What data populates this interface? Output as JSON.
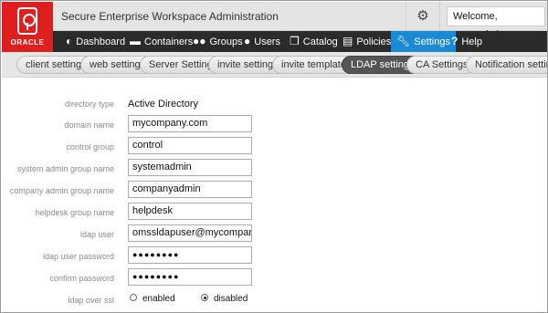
{
  "header": {
    "logo_text": "ORACLE",
    "app_title": "Secure Enterprise Workspace Administration",
    "welcome": "Welcome, msacadmin"
  },
  "nav": {
    "items": [
      {
        "label": "Dashboard",
        "icon": "dashboard-icon"
      },
      {
        "label": "Containers",
        "icon": "containers-icon"
      },
      {
        "label": "Groups",
        "icon": "groups-icon"
      },
      {
        "label": "Users",
        "icon": "user-icon"
      },
      {
        "label": "Catalog",
        "icon": "catalog-icon"
      },
      {
        "label": "Policies",
        "icon": "policies-icon"
      },
      {
        "label": "Settings",
        "icon": "wrench-icon"
      },
      {
        "label": "Help",
        "icon": "question-icon"
      }
    ],
    "active": "Settings"
  },
  "subnav": {
    "tabs": [
      "client settings",
      "web settings",
      "Server Settings",
      "invite settings",
      "invite templates",
      "LDAP settings",
      "CA Settings",
      "Notification settings"
    ],
    "active": "LDAP settings"
  },
  "form": {
    "directory_type": {
      "label": "directory type",
      "value": "Active Directory"
    },
    "domain_name": {
      "label": "domain name",
      "value": "mycompany.com"
    },
    "control_group": {
      "label": "control group",
      "value": "control"
    },
    "system_admin_group": {
      "label": "system admin group name",
      "value": "systemadmin"
    },
    "company_admin_group": {
      "label": "company admin group name",
      "value": "companyadmin"
    },
    "helpdesk_group": {
      "label": "helpdesk group name",
      "value": "helpdesk"
    },
    "ldap_user": {
      "label": "ldap user",
      "value": "omssldapuser@mycompany.com"
    },
    "ldap_password": {
      "label": "ldap user password",
      "value": "●●●●●●●●"
    },
    "confirm_password": {
      "label": "confirm password",
      "value": "●●●●●●●●"
    },
    "ldap_over_ssl": {
      "label": "ldap over ssl",
      "options": [
        "enabled",
        "disabled"
      ],
      "selected": "disabled"
    }
  },
  "colors": {
    "brand_red": "#e01e1e",
    "nav_bg": "#2b2b2b",
    "nav_active": "#1a8ad4",
    "pill_active": "#555555"
  }
}
